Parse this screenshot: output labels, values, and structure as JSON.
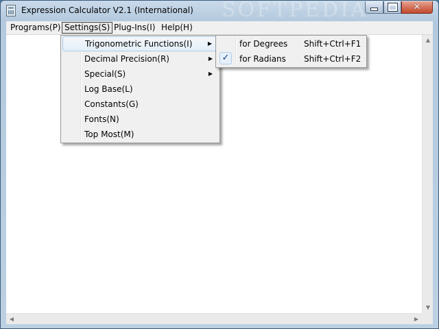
{
  "window": {
    "title": "Expression Calculator V2.1 (International)",
    "watermark": "SOFTPEDIA",
    "controls": {
      "minimize": "minimize",
      "maximize": "maximize",
      "close": "✕"
    }
  },
  "menubar": {
    "items": [
      {
        "label": "Programs(P)"
      },
      {
        "label": "Settings(S)",
        "selected": true
      },
      {
        "label": "Plug-Ins(I)"
      },
      {
        "label": "Help(H)"
      }
    ]
  },
  "settings_menu": {
    "items": [
      {
        "label": "Trigonometric Functions(I)",
        "submenu": true,
        "highlighted": true
      },
      {
        "label": "Decimal Precision(R)",
        "submenu": true
      },
      {
        "label": "Special(S)",
        "submenu": true
      },
      {
        "label": "Log Base(L)"
      },
      {
        "label": "Constants(G)"
      },
      {
        "label": "Fonts(N)"
      },
      {
        "label": "Top Most(M)"
      }
    ],
    "submenu_arrow": "▶"
  },
  "trig_submenu": {
    "items": [
      {
        "label": "for Degrees",
        "shortcut": "Shift+Ctrl+F1",
        "checked": false
      },
      {
        "label": "for Radians",
        "shortcut": "Shift+Ctrl+F2",
        "checked": true
      }
    ],
    "check_mark": "✓"
  },
  "scrollbars": {
    "up_arrow": "▲",
    "down_arrow": "▼",
    "left_arrow": "◀",
    "right_arrow": "▶"
  }
}
